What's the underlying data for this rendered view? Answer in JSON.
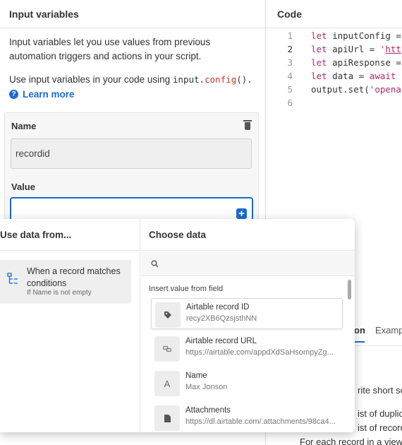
{
  "left": {
    "title": "Input variables",
    "description": "Input variables let you use values from previous automation triggers and actions in your script.",
    "usage_prefix": "Use input variables in your code using",
    "usage_code_obj": "input.",
    "usage_code_fn": "config",
    "usage_code_end": "().",
    "learn_more": "Learn more",
    "name_label": "Name",
    "name_value": "recordid",
    "value_label": "Value",
    "value_input": ""
  },
  "code": {
    "title": "Code",
    "lines": [
      {
        "n": "1",
        "kw": "let",
        "rest": " inputConfig ="
      },
      {
        "n": "2",
        "kw": "let",
        "rest": " apiUrl = ",
        "str": "'",
        "url": "htt"
      },
      {
        "n": "3",
        "kw": "let",
        "rest": " apiResponse ="
      },
      {
        "n": "4",
        "kw": "let",
        "rest": " data = ",
        "kw2": "await"
      },
      {
        "n": "5",
        "plain": "output.set(",
        "str": "'opena"
      },
      {
        "n": "6"
      }
    ]
  },
  "docs": {
    "tab_active": "on",
    "tab_examples": "Examp",
    "text1": "rite short sc",
    "text2": "ist of duplica",
    "text3": "ist of record",
    "text4": "For each record in a view,"
  },
  "dropdown": {
    "left_header": "Use data from...",
    "source_title": "When a record matches conditions",
    "source_sub": "If Name is not empty",
    "right_header": "Choose data",
    "search_placeholder": "",
    "insert_label": "Insert value from field",
    "fields": [
      {
        "name": "Airtable record ID",
        "value": "recy2XB6QzsjsthNN",
        "icon": "tag-icon"
      },
      {
        "name": "Airtable record URL",
        "value": "https://airtable.com/appdXdSaHsompyZg...",
        "icon": "link-icon"
      },
      {
        "name": "Name",
        "value": "Max Jonson",
        "icon": "text-field-icon",
        "glyph": "A"
      },
      {
        "name": "Attachments",
        "value": "https://dl.airtable.com/.attachments/98ca4...",
        "icon": "file-icon"
      }
    ]
  },
  "colors": {
    "accent": "#1a6bd3",
    "code_keyword": "#b5286f"
  }
}
